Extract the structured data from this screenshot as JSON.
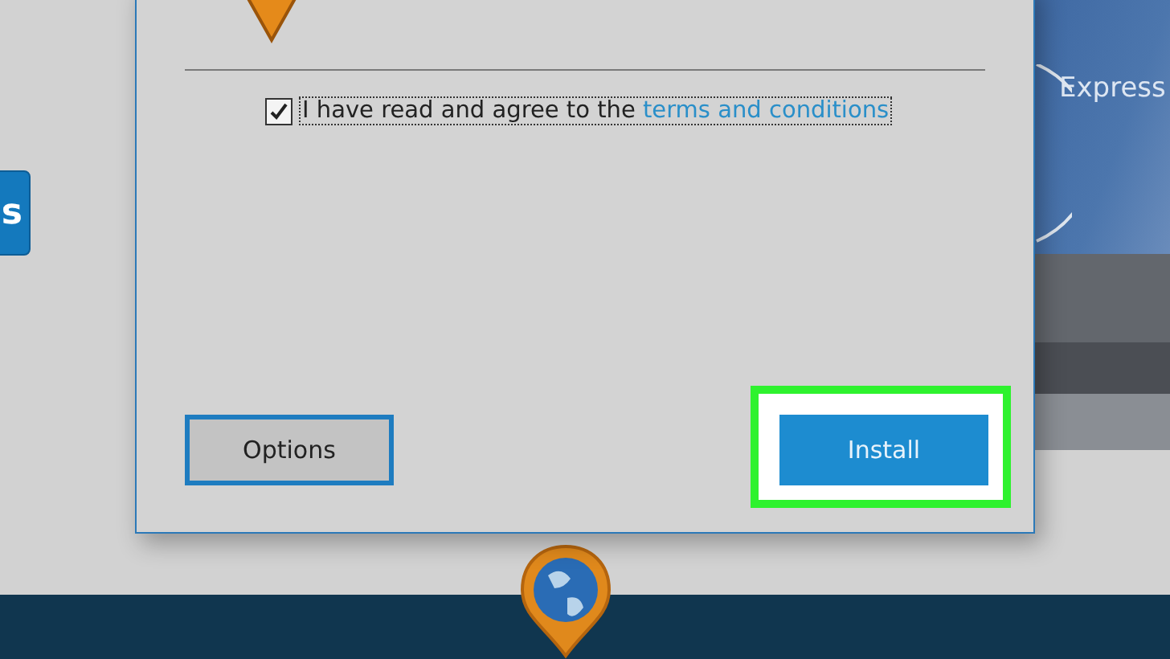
{
  "background": {
    "side_button": "s",
    "banner": "Express"
  },
  "dialog": {
    "consent": {
      "checked": true,
      "text": "I have read and agree to the ",
      "link": "terms and conditions"
    },
    "buttons": [
      {
        "label": "Options",
        "kind": "secondary",
        "highlighted": false
      },
      {
        "label": "Install",
        "kind": "primary",
        "highlighted": true
      }
    ]
  }
}
